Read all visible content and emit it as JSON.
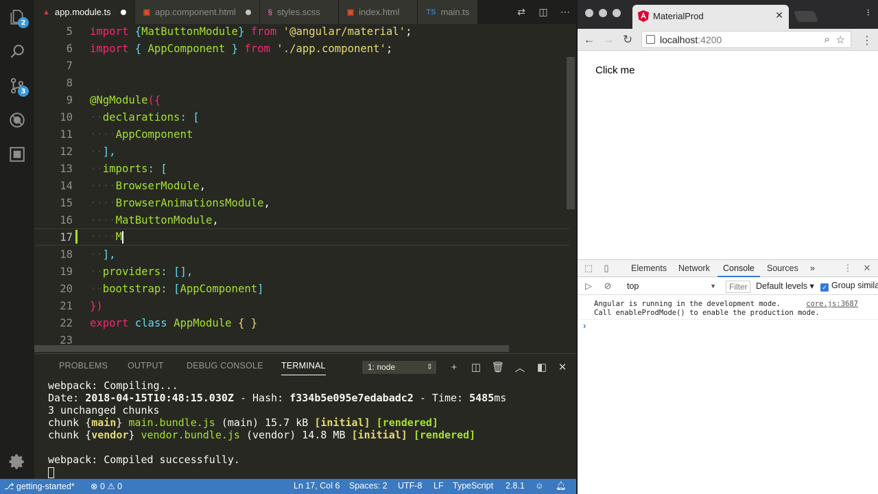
{
  "vscode": {
    "activity_badges": {
      "explorer": "2",
      "source_control": "3"
    },
    "tabs": [
      {
        "label": "app.module.ts",
        "icon": "angular-file-icon",
        "icon_color": "#e23237",
        "dirty": true,
        "active": true
      },
      {
        "label": "app.component.html",
        "icon": "html-file-icon",
        "icon_color": "#e44d26",
        "dirty": true,
        "active": false
      },
      {
        "label": "styles.scss",
        "icon": "sass-file-icon",
        "icon_color": "#cf649a",
        "dirty": false,
        "active": false
      },
      {
        "label": "index.html",
        "icon": "html-file-icon",
        "icon_color": "#e44d26",
        "dirty": false,
        "active": false
      },
      {
        "label": "main.ts",
        "icon": "typescript-file-icon",
        "icon_color": "#3178c6",
        "dirty": false,
        "active": false
      }
    ],
    "line_numbers": [
      "5",
      "6",
      "7",
      "8",
      "9",
      "10",
      "11",
      "12",
      "13",
      "14",
      "15",
      "16",
      "17",
      "18",
      "19",
      "20",
      "21",
      "22",
      "23"
    ],
    "code": {
      "l5": {
        "kw1": "import",
        "brace_open": " {",
        "ident": "MatButtonModule",
        "brace_close": "} ",
        "kw2": "from",
        "str": " '@angular/material'",
        "end": ";"
      },
      "l6": {
        "kw1": "import",
        "brace_open": " { ",
        "ident": "AppComponent",
        "brace_close": " } ",
        "kw2": "from",
        "str": " './app.component'",
        "end": ";"
      },
      "l9": {
        "decorator": "@NgModule",
        "rest": "({"
      },
      "l10": {
        "key": "declarations",
        "rest": ": ["
      },
      "l11": {
        "ident": "AppComponent"
      },
      "l12": {
        "text": "],"
      },
      "l13": {
        "key": "imports",
        "rest": ": ["
      },
      "l14": {
        "ident": "BrowserModule",
        "rest": ","
      },
      "l15": {
        "ident": "BrowserAnimationsModule",
        "rest": ","
      },
      "l16": {
        "ident": "MatButtonModule",
        "rest": ","
      },
      "l17": {
        "ident": "M"
      },
      "l18": {
        "text": "],"
      },
      "l19": {
        "key": "providers",
        "rest": ": [],"
      },
      "l20": {
        "key": "bootstrap",
        "rest": ": [",
        "ident": "AppComponent",
        "close": "]"
      },
      "l21": {
        "text": "})"
      },
      "l22": {
        "kw1": "export",
        "kw2": "class",
        "ident": "AppModule",
        "rest": " { }"
      }
    },
    "panel": {
      "tabs": [
        "PROBLEMS",
        "OUTPUT",
        "DEBUG CONSOLE",
        "TERMINAL"
      ],
      "active_tab": "TERMINAL",
      "terminal_select": "1: node",
      "terminal": {
        "line1": "webpack: Compiling...",
        "date_label": "Date: ",
        "date_value": "2018-04-15T10:48:15.030Z",
        "hash_label": " - Hash: ",
        "hash_value": "f334b5e095e7edabadc2",
        "time_label": " - Time: ",
        "time_value": "5485",
        "time_unit": "ms",
        "line3": "3 unchanged chunks",
        "chunk1_prefix": "chunk {",
        "chunk1_name": "main",
        "chunk1_close": "} ",
        "chunk1_file": "main.bundle.js",
        "chunk1_info": " (main) 15.7 kB ",
        "chunk2_prefix": "chunk {",
        "chunk2_name": "vendor",
        "chunk2_close": "} ",
        "chunk2_file": "vendor.bundle.js",
        "chunk2_info": " (vendor) 14.8 MB ",
        "flag_initial": "[initial]",
        "flag_rendered": "[rendered]",
        "compiled": "webpack: Compiled successfully."
      }
    },
    "status": {
      "branch": "getting-started*",
      "errors": "0",
      "warnings": "0",
      "position": "Ln 17, Col 6",
      "spaces": "Spaces: 2",
      "encoding": "UTF-8",
      "eol": "LF",
      "language": "TypeScript",
      "version": "2.8.1"
    },
    "colors": {
      "status_bar": "#3b79c0",
      "editor_bg": "#272822",
      "keyword": "#f92672",
      "string": "#e6db74",
      "identifier": "#a6e22e",
      "brace": "#66d9ef"
    }
  },
  "chrome": {
    "tab_title": "MaterialProd",
    "url_host": "localhost",
    "url_port": ":4200",
    "page": {
      "button_label": "Click me"
    },
    "devtools": {
      "tabs": [
        "Elements",
        "Network",
        "Console",
        "Sources"
      ],
      "active_tab": "Console",
      "more": "»",
      "context": "top",
      "filter_placeholder": "Filter",
      "levels": "Default levels",
      "group_similar": "Group simila",
      "message_line1": "Angular is running in the development mode.",
      "message_line2": "Call enableProdMode() to enable the production mode.",
      "message_source": "core.js:3687"
    }
  }
}
